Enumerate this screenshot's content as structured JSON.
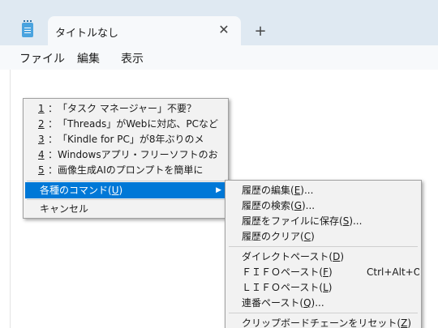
{
  "tab": {
    "title": "タイトルなし",
    "close_glyph": "✕",
    "new_glyph": "+"
  },
  "menubar": [
    "ファイル",
    "編集",
    "表示"
  ],
  "history": [
    {
      "num": "1",
      "sep": "：",
      "text": "「タスク マネージャー」不要？"
    },
    {
      "num": "2",
      "sep": "：",
      "text": "「Threads」がWebに対応、PCなど"
    },
    {
      "num": "3",
      "sep": "：",
      "text": "「Kindle for PC」が8年ぶりのメ"
    },
    {
      "num": "4",
      "sep": "：",
      "text": "Windowsアプリ・フリーソフトのお"
    },
    {
      "num": "5",
      "sep": "：",
      "text": "画像生成AIのプロンプトを簡単に"
    }
  ],
  "commands_item": {
    "label": "各種のコマンド(",
    "key": "U",
    "suffix": ")",
    "arrow": "▶"
  },
  "cancel_label": "キャンセル",
  "submenu": [
    {
      "label": "履歴の編集(",
      "key": "E",
      "suffix": ")..."
    },
    {
      "label": "履歴の検索(",
      "key": "G",
      "suffix": ")..."
    },
    {
      "label": "履歴をファイルに保存(",
      "key": "S",
      "suffix": ")..."
    },
    {
      "label": "履歴のクリア(",
      "key": "C",
      "suffix": ")"
    },
    {
      "label": "ダイレクトペースト(",
      "key": "D",
      "suffix": ")"
    },
    {
      "label": "ＦＩＦＯペースト(",
      "key": "F",
      "suffix": ")",
      "shortcut": "Ctrl+Alt+O"
    },
    {
      "label": "ＬＩＦＯペースト(",
      "key": "L",
      "suffix": ")"
    },
    {
      "label": "連番ペースト(",
      "key": "Q",
      "suffix": ")..."
    },
    {
      "label": "クリップボードチェーンをリセット(",
      "key": "Z",
      "suffix": ")"
    }
  ],
  "colors": {
    "highlight": "#0078d7",
    "menu_bg": "#f2f2f2",
    "chrome_bg": "#dfe9f2"
  }
}
